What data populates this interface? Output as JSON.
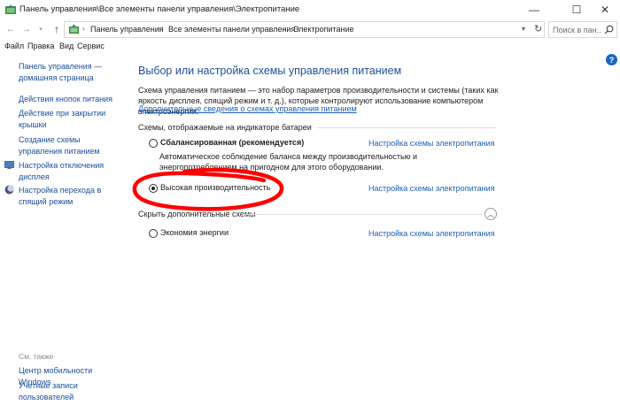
{
  "window": {
    "title": "Панель управления\\Все элементы панели управления\\Электропитание",
    "minimize_glyph": "—",
    "maximize_glyph": "☐",
    "close_glyph": "✕"
  },
  "nav": {
    "back_glyph": "←",
    "forward_glyph": "→",
    "recent_glyph": "▾",
    "up_glyph": "↑",
    "breadcrumbs": [
      "Панель управления",
      "Все элементы панели управления",
      "Электропитание"
    ],
    "separator": "›",
    "dropdown_glyph": "▾",
    "refresh_glyph": "↻",
    "search_placeholder": "Поиск в пан..."
  },
  "menu": {
    "items": [
      "Файл",
      "Правка",
      "Вид",
      "Сервис"
    ]
  },
  "help": {
    "glyph": "?"
  },
  "sidebar": {
    "home": "Панель управления — домашняя страница",
    "links": [
      "Действия кнопок питания",
      "Действие при закрытии крышки",
      "Создание схемы управления питанием",
      "Настройка отключения дисплея",
      "Настройка перехода в спящий режим"
    ],
    "see_also_label": "См. также",
    "see_also": [
      "Центр мобильности Windows",
      "Учетные записи пользователей"
    ]
  },
  "main": {
    "heading": "Выбор или настройка схемы управления питанием",
    "description": "Схема управления питанием — это набор параметров производительности и системы (таких как яркость дисплея, спящий режим и т. д.), которые контролируют использование компьютером электроэнергии.",
    "more_link": "Дополнительные сведения о схемах управления питанием",
    "group_title": "Схемы, отображаемые на индикаторе батареи",
    "plans": [
      {
        "label": "Сбалансированная (рекомендуется)",
        "link": "Настройка схемы электропитания",
        "selected": false
      },
      {
        "label": "Высокая производительность",
        "link": "Настройка схемы электропитания",
        "selected": true
      }
    ],
    "balanced_description": "Автоматическое соблюдение баланса между производительностью и энергопотреблением на пригодном для этого оборудовании.",
    "hidden_group_label": "Скрыть дополнительные схемы",
    "collapse_glyph": "︿",
    "hidden_plans": [
      {
        "label": "Экономия энергии",
        "link": "Настройка схемы электропитания",
        "selected": false
      }
    ]
  },
  "colors": {
    "link": "#1a5fb4",
    "heading": "#1e4f97",
    "annotation": "#ff0000"
  }
}
